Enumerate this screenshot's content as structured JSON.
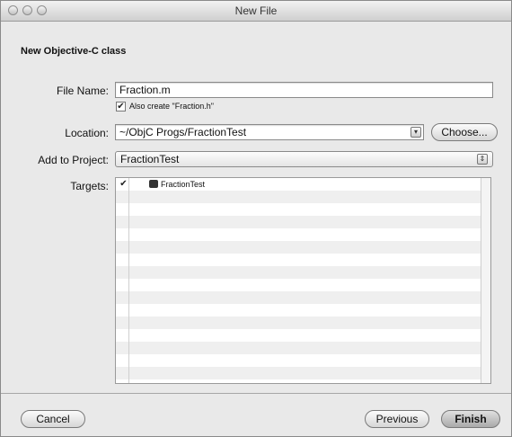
{
  "window": {
    "title": "New File"
  },
  "header": {
    "heading": "New Objective-C class"
  },
  "form": {
    "file_name_label": "File Name:",
    "file_name_value": "Fraction.m",
    "also_create_label": "Also create \"Fraction.h\"",
    "location_label": "Location:",
    "location_value": "~/ObjC Progs/FractionTest",
    "choose_button": "Choose...",
    "add_to_project_label": "Add to Project:",
    "add_to_project_value": "FractionTest",
    "targets_label": "Targets:",
    "targets": [
      {
        "name": "FractionTest",
        "checked": true
      }
    ]
  },
  "footer": {
    "cancel": "Cancel",
    "previous": "Previous",
    "finish": "Finish"
  }
}
